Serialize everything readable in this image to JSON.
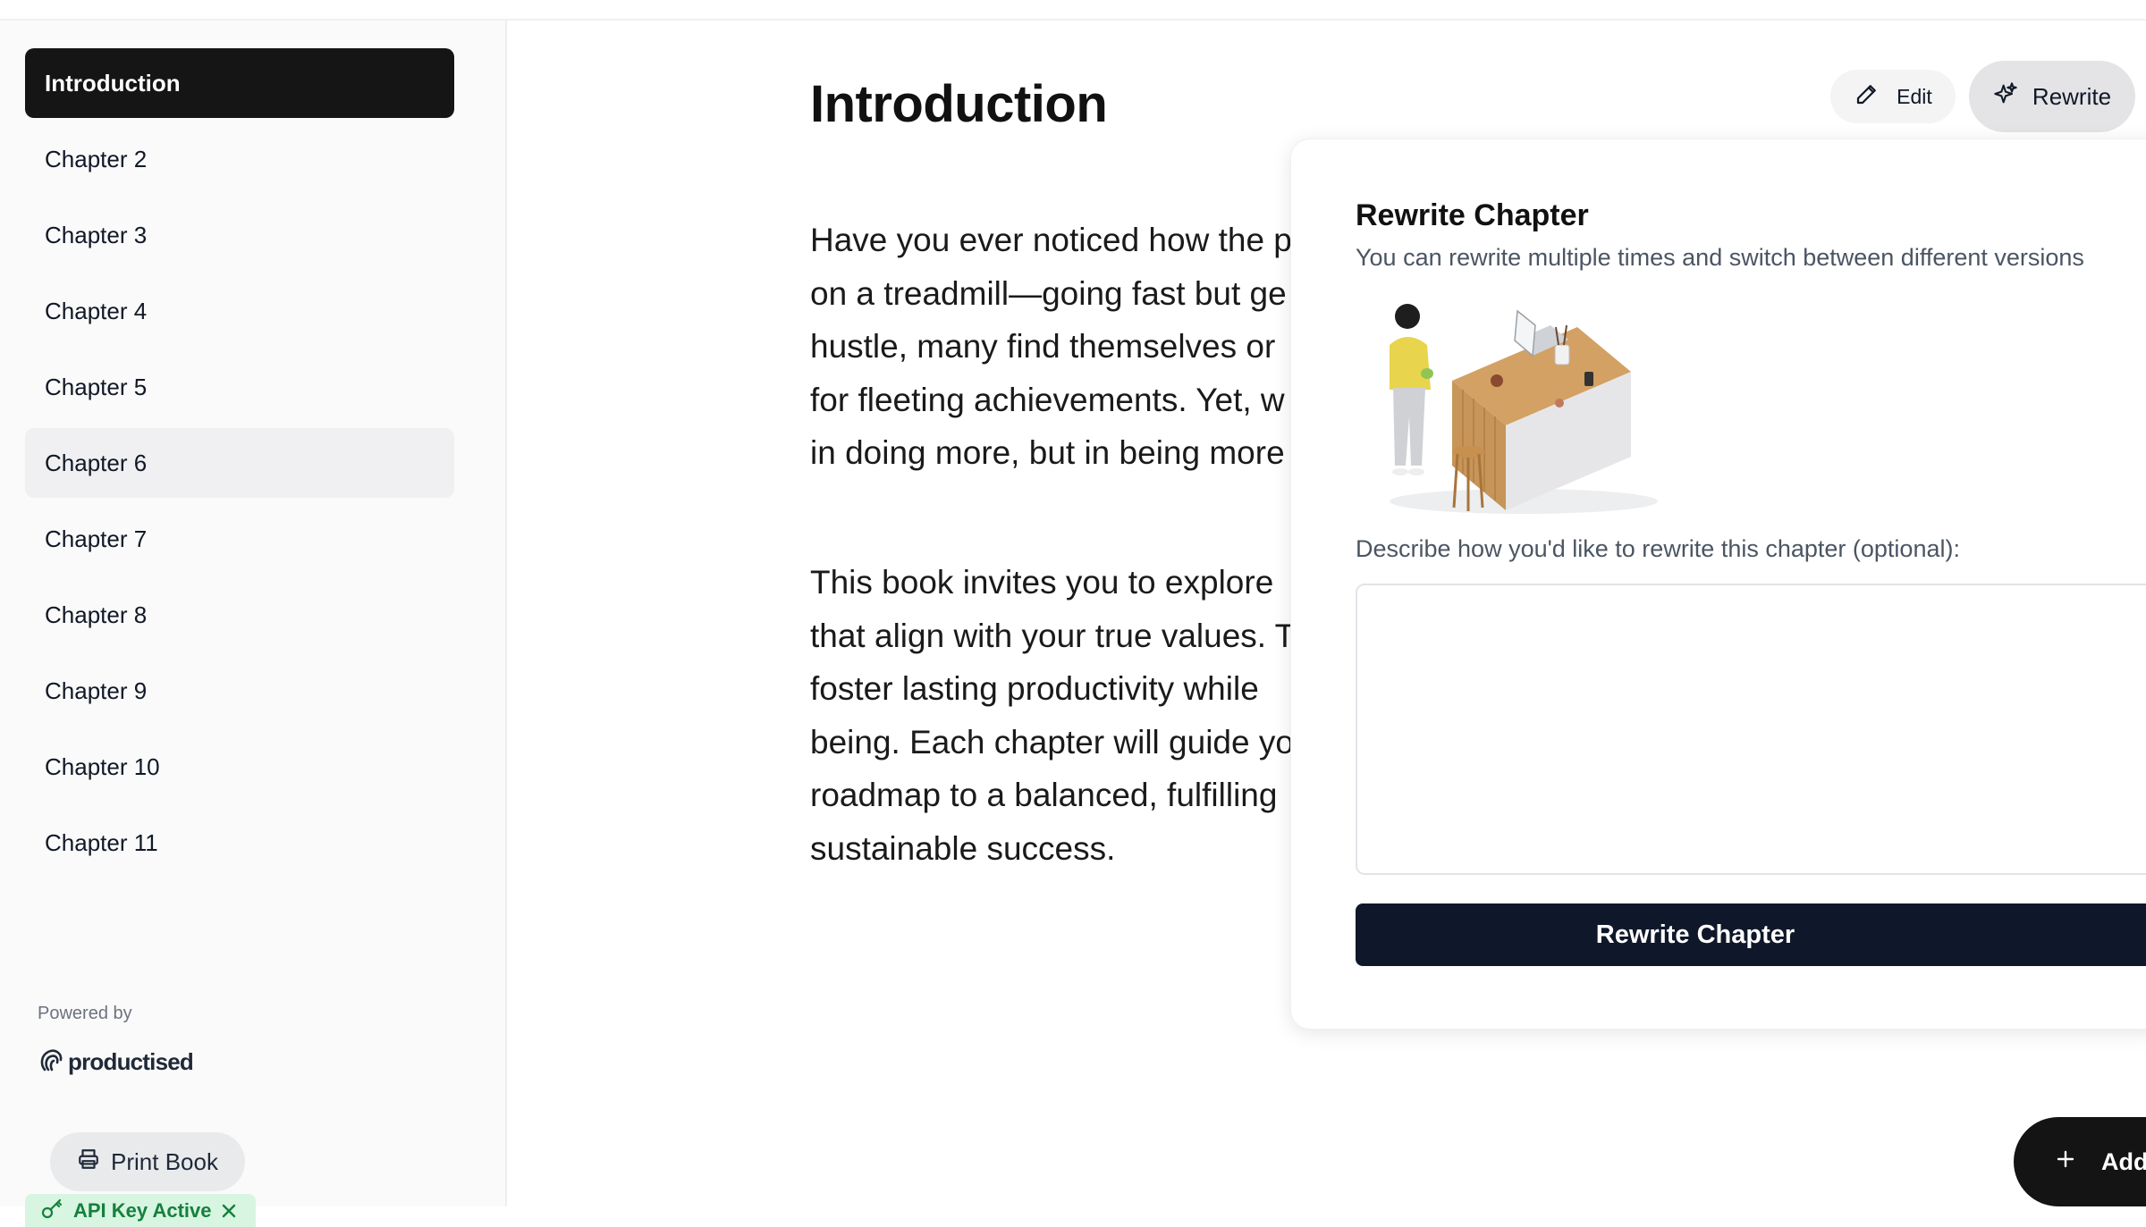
{
  "sidebar": {
    "items": [
      {
        "label": "Introduction",
        "state": "active"
      },
      {
        "label": "Chapter 2"
      },
      {
        "label": "Chapter 3"
      },
      {
        "label": "Chapter 4"
      },
      {
        "label": "Chapter 5"
      },
      {
        "label": "Chapter 6",
        "state": "hover"
      },
      {
        "label": "Chapter 7"
      },
      {
        "label": "Chapter 8"
      },
      {
        "label": "Chapter 9"
      },
      {
        "label": "Chapter 10"
      },
      {
        "label": "Chapter 11"
      }
    ],
    "powered_by": "Powered by",
    "logo_text": "productised",
    "print_label": "Print Book",
    "api_badge_label": "API Key Active"
  },
  "main": {
    "title": "Introduction",
    "paragraph1": [
      "Have you ever noticed how the p",
      "on a treadmill—going fast but ge",
      "hustle, many find themselves or",
      "for fleeting achievements. Yet, w",
      "in doing more, but in being more"
    ],
    "paragraph2": [
      "This book invites you to explore",
      "that align with your true values. T",
      "foster lasting productivity while",
      "being. Each chapter will guide yo",
      "roadmap to a balanced, fulfilling",
      "sustainable success."
    ],
    "edit_label": "Edit",
    "rewrite_label": "Rewrite",
    "add_label": "Add"
  },
  "rewrite_panel": {
    "title": "Rewrite Chapter",
    "subtitle": "You can rewrite multiple times and switch between different versions",
    "prompt_label": "Describe how you'd like to rewrite this chapter (optional):",
    "prompt_value": "",
    "prompt_placeholder": "",
    "submit_label": "Rewrite Chapter"
  },
  "colors": {
    "active_nav_bg": "#151515",
    "primary_button": "#0f172a",
    "api_badge_bg": "#d8f5e1",
    "api_badge_text": "#15803d"
  },
  "icons": [
    "pencil-icon",
    "sparkles-icon",
    "printer-icon",
    "key-icon",
    "close-icon",
    "plus-icon",
    "productised-logo-icon"
  ]
}
